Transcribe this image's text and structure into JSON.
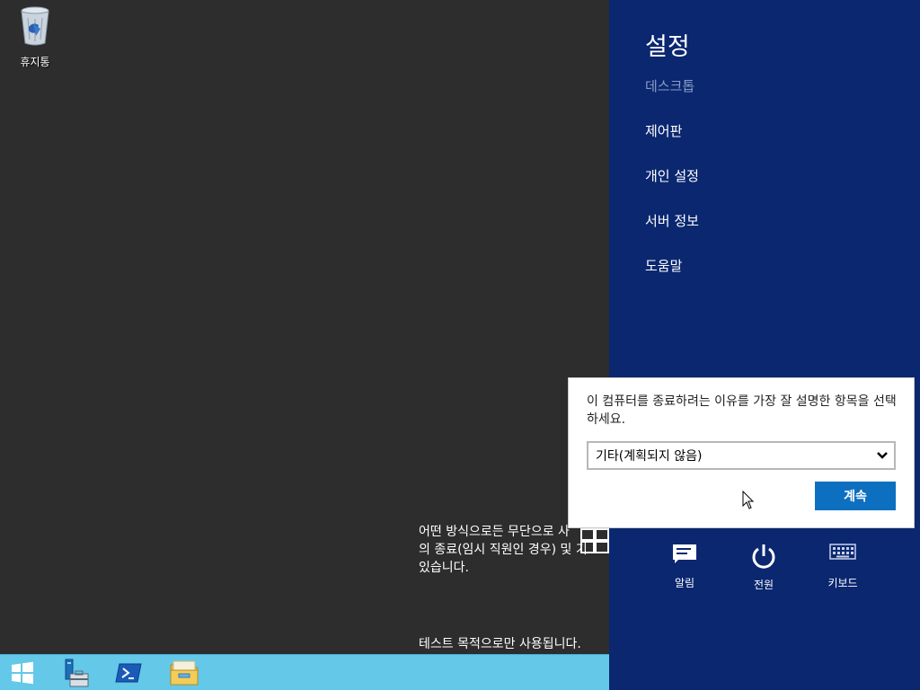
{
  "desktop": {
    "recycle_bin_label": "휴지통",
    "notice_lines": [
      "어떤 방식으로든 무단으로 사",
      "의 종료(임시 직원인 경우) 및 기",
      "있습니다."
    ],
    "test_text": "테스트 목적으로만 사용됩니다."
  },
  "taskbar": {
    "items": [
      "start-icon",
      "server-manager-icon",
      "powershell-icon",
      "file-explorer-icon"
    ]
  },
  "charms": {
    "title": "설정",
    "subtitle": "데스크톱",
    "items": [
      {
        "label": "제어판"
      },
      {
        "label": "개인 설정"
      },
      {
        "label": "서버 정보"
      },
      {
        "label": "도움말"
      }
    ],
    "buttons": [
      {
        "label": "알림",
        "icon": "notification-icon"
      },
      {
        "label": "전원",
        "icon": "power-icon"
      },
      {
        "label": "키보드",
        "icon": "keyboard-icon"
      }
    ]
  },
  "dialog": {
    "prompt": "이 컴퓨터를 종료하려는 이유를 가장 잘 설명한 항목을 선택하세요.",
    "selected_reason": "기타(계획되지 않음)",
    "continue_label": "계속"
  },
  "colors": {
    "charms_bg": "#0a2770",
    "taskbar_bg": "#64c8e8",
    "desktop_bg": "#2d2d2d",
    "button_blue": "#0d6fc0"
  }
}
